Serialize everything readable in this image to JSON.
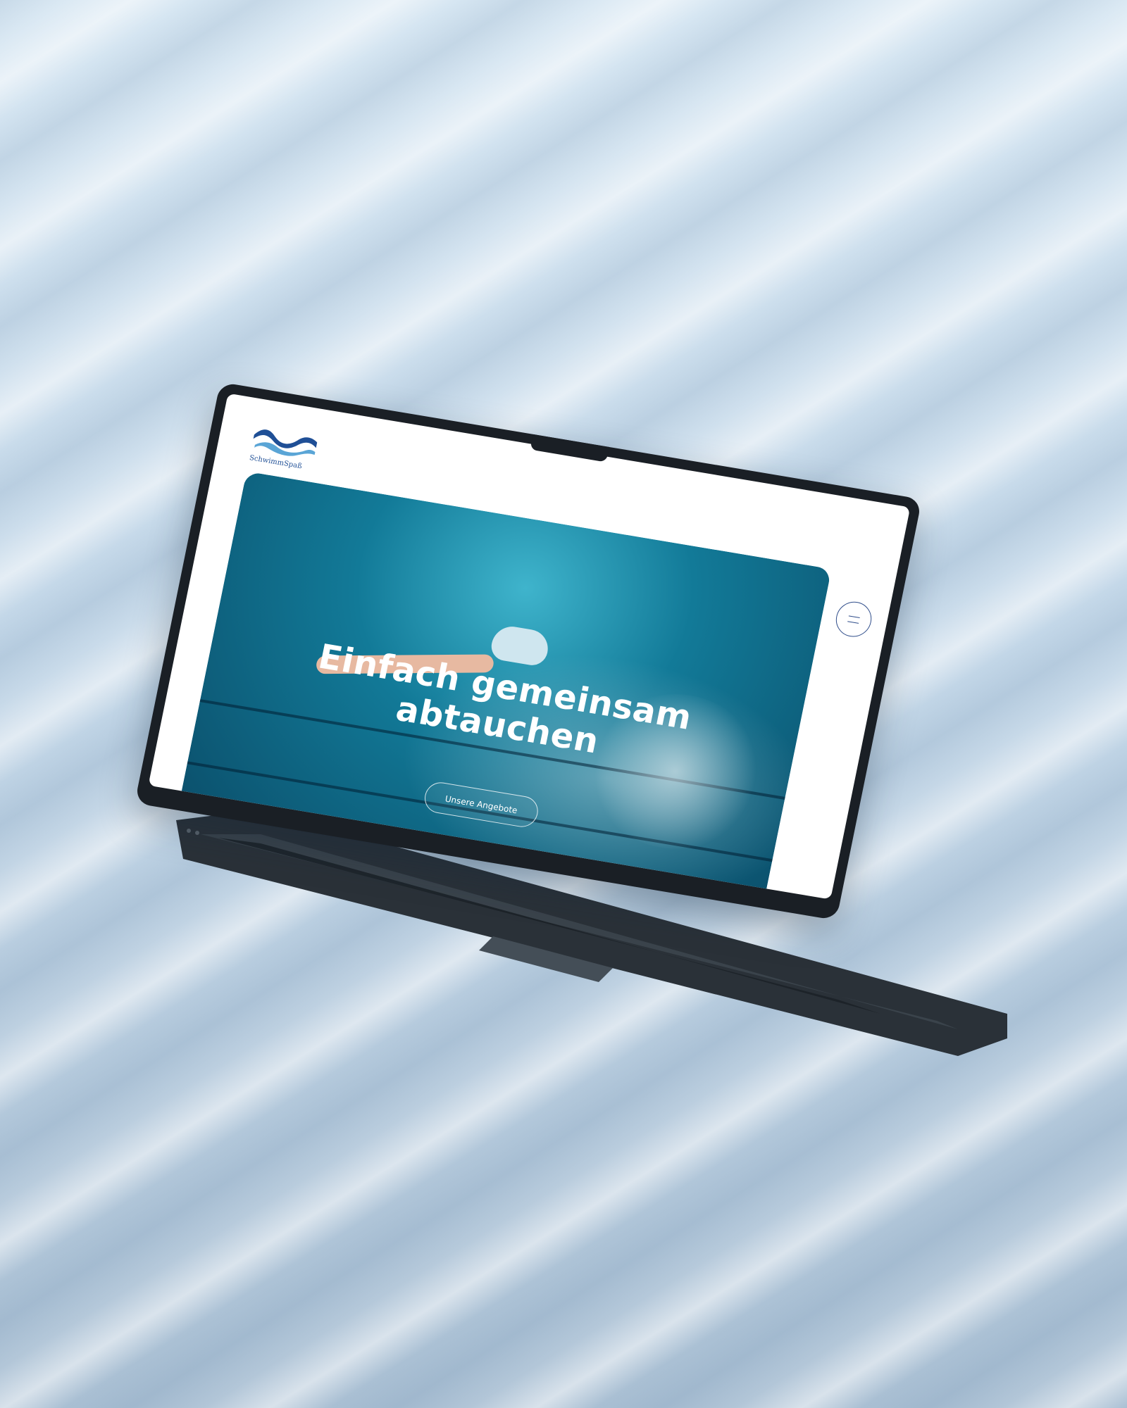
{
  "site": {
    "logo_text": "SchwimmSpaß"
  },
  "hero": {
    "headline_line1": "Einfach gemeinsam",
    "headline_line2": "abtauchen",
    "cta_label": "Unsere Angebote"
  },
  "icons": {
    "menu": "hamburger-menu-icon",
    "logo": "wave-logo-icon"
  },
  "colors": {
    "brand_blue": "#1f4f96",
    "menu_outline": "#2f4d8a",
    "hero_teal": "#127a98",
    "laptop_body": "#1a1f25"
  }
}
